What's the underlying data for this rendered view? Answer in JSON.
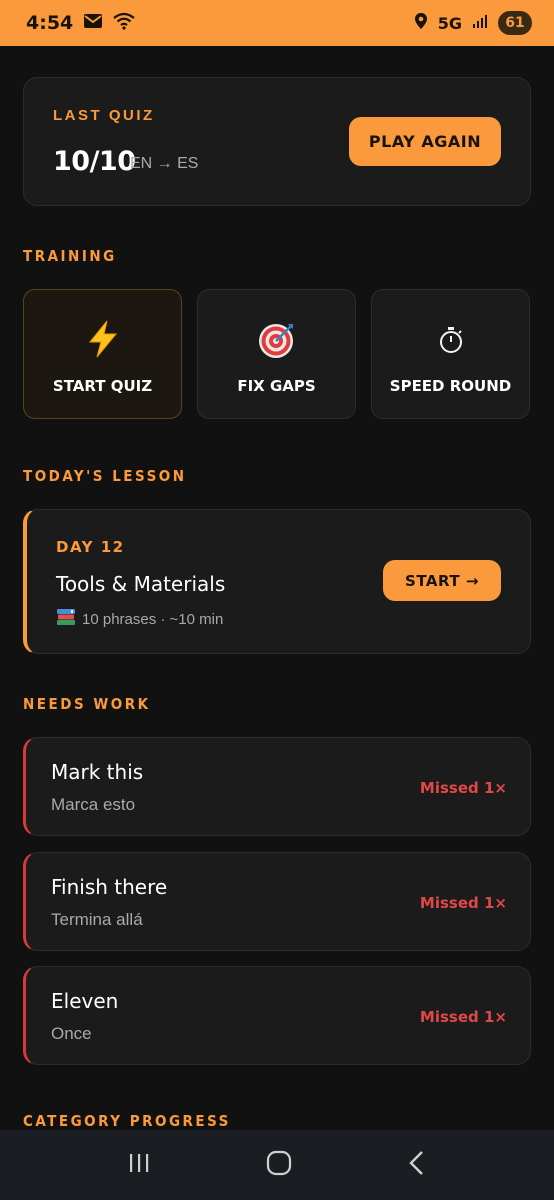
{
  "status_bar": {
    "time": "4:54",
    "network": "5G",
    "battery": "61",
    "icons": [
      "mail-icon",
      "wifi-icon",
      "location-icon",
      "signal-icon"
    ]
  },
  "last_quiz": {
    "label": "LAST QUIZ",
    "score": "10/10",
    "languages": "EN → ES",
    "play_again": "PLAY AGAIN"
  },
  "training": {
    "title": "TRAINING",
    "tiles": [
      {
        "label": "START QUIZ",
        "icon": "lightning-icon"
      },
      {
        "label": "FIX GAPS",
        "icon": "target-icon"
      },
      {
        "label": "SPEED ROUND",
        "icon": "stopwatch-icon"
      }
    ]
  },
  "lesson": {
    "title": "TODAY'S LESSON",
    "day": "DAY 12",
    "name": "Tools & Materials",
    "meta": "10 phrases · ~10 min",
    "start": "START →"
  },
  "needs_work": {
    "title": "NEEDS WORK",
    "items": [
      {
        "phrase": "Mark this",
        "translation": "Marca esto",
        "missed": "Missed 1×"
      },
      {
        "phrase": "Finish there",
        "translation": "Termina allá",
        "missed": "Missed 1×"
      },
      {
        "phrase": "Eleven",
        "translation": "Once",
        "missed": "Missed 1×"
      }
    ]
  },
  "category_progress": {
    "title": "CATEGORY PROGRESS"
  },
  "colors": {
    "accent": "#fb9a3c",
    "danger": "#e04848",
    "background": "#111111",
    "card": "#1b1b1b"
  }
}
